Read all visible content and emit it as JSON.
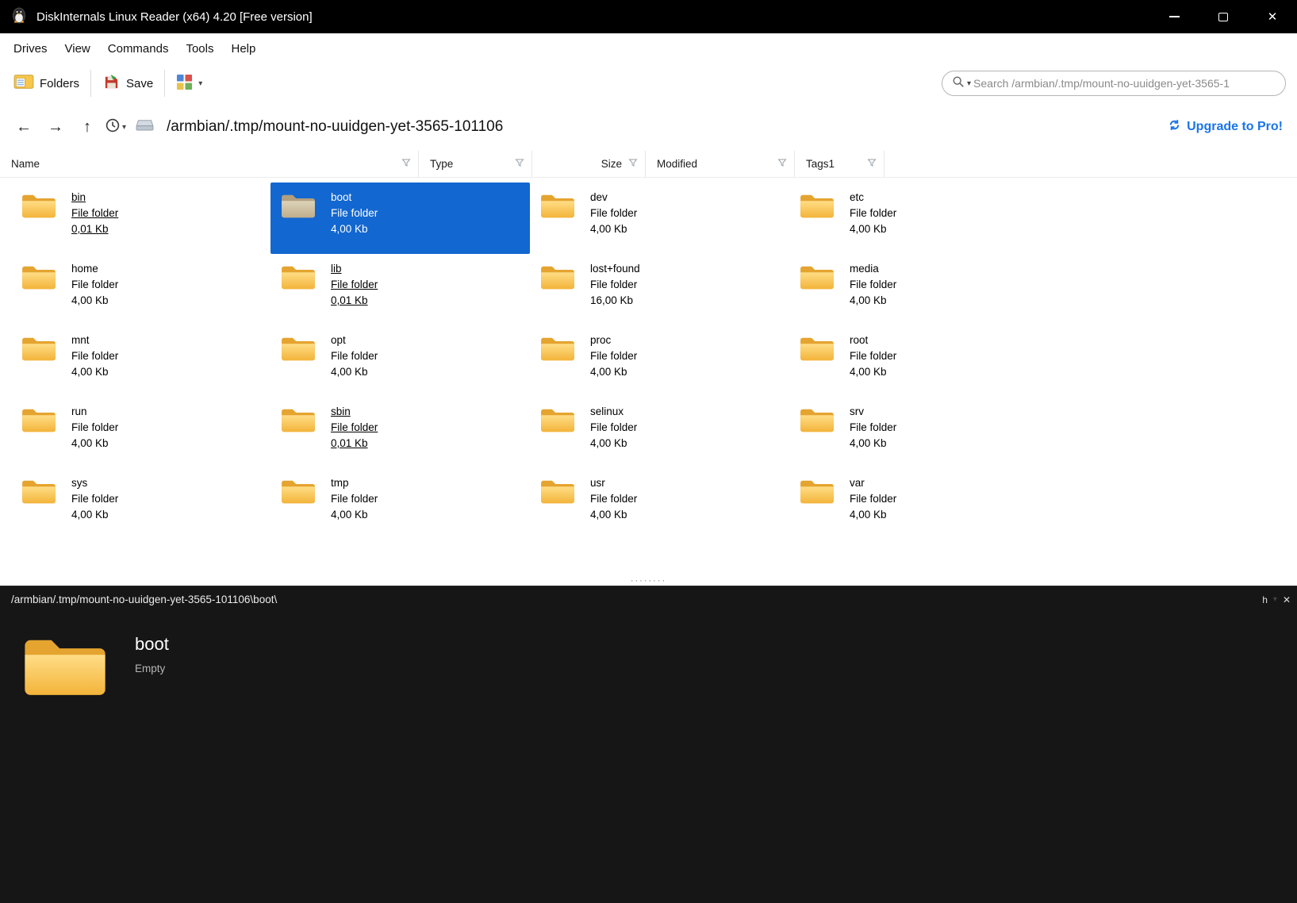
{
  "window": {
    "title": "DiskInternals Linux Reader (x64) 4.20 [Free version]"
  },
  "menu": {
    "items": [
      "Drives",
      "View",
      "Commands",
      "Tools",
      "Help"
    ]
  },
  "toolbar": {
    "folders_label": "Folders",
    "save_label": "Save",
    "search_placeholder": "Search /armbian/.tmp/mount-no-uuidgen-yet-3565-1"
  },
  "navbar": {
    "path": "/armbian/.tmp/mount-no-uuidgen-yet-3565-101106",
    "upgrade_label": "Upgrade to Pro!"
  },
  "columns": [
    {
      "label": "Name"
    },
    {
      "label": "Type"
    },
    {
      "label": "Size",
      "align": "right"
    },
    {
      "label": "Modified"
    },
    {
      "label": "Tags1"
    }
  ],
  "files": [
    {
      "name": "bin",
      "type": "File folder",
      "size": "0,01 Kb",
      "link": true,
      "selected": false
    },
    {
      "name": "boot",
      "type": "File folder",
      "size": "4,00 Kb",
      "link": false,
      "selected": true
    },
    {
      "name": "dev",
      "type": "File folder",
      "size": "4,00 Kb",
      "link": false,
      "selected": false
    },
    {
      "name": "etc",
      "type": "File folder",
      "size": "4,00 Kb",
      "link": false,
      "selected": false
    },
    {
      "name": "home",
      "type": "File folder",
      "size": "4,00 Kb",
      "link": false,
      "selected": false
    },
    {
      "name": "lib",
      "type": "File folder",
      "size": "0,01 Kb",
      "link": true,
      "selected": false
    },
    {
      "name": "lost+found",
      "type": "File folder",
      "size": "16,00 Kb",
      "link": false,
      "selected": false
    },
    {
      "name": "media",
      "type": "File folder",
      "size": "4,00 Kb",
      "link": false,
      "selected": false
    },
    {
      "name": "mnt",
      "type": "File folder",
      "size": "4,00 Kb",
      "link": false,
      "selected": false
    },
    {
      "name": "opt",
      "type": "File folder",
      "size": "4,00 Kb",
      "link": false,
      "selected": false
    },
    {
      "name": "proc",
      "type": "File folder",
      "size": "4,00 Kb",
      "link": false,
      "selected": false
    },
    {
      "name": "root",
      "type": "File folder",
      "size": "4,00 Kb",
      "link": false,
      "selected": false
    },
    {
      "name": "run",
      "type": "File folder",
      "size": "4,00 Kb",
      "link": false,
      "selected": false
    },
    {
      "name": "sbin",
      "type": "File folder",
      "size": "0,01 Kb",
      "link": true,
      "selected": false
    },
    {
      "name": "selinux",
      "type": "File folder",
      "size": "4,00 Kb",
      "link": false,
      "selected": false
    },
    {
      "name": "srv",
      "type": "File folder",
      "size": "4,00 Kb",
      "link": false,
      "selected": false
    },
    {
      "name": "sys",
      "type": "File folder",
      "size": "4,00 Kb",
      "link": false,
      "selected": false
    },
    {
      "name": "tmp",
      "type": "File folder",
      "size": "4,00 Kb",
      "link": false,
      "selected": false
    },
    {
      "name": "usr",
      "type": "File folder",
      "size": "4,00 Kb",
      "link": false,
      "selected": false
    },
    {
      "name": "var",
      "type": "File folder",
      "size": "4,00 Kb",
      "link": false,
      "selected": false
    }
  ],
  "preview": {
    "path": "/armbian/.tmp/mount-no-uuidgen-yet-3565-101106\\boot\\",
    "corner_label": "h",
    "name": "boot",
    "status": "Empty"
  },
  "icons": {
    "close": "✕",
    "caret": "▾",
    "grip": "········",
    "back": "←",
    "forward": "→",
    "up": "↑"
  },
  "colors": {
    "selection": "#1267d1",
    "accent_blue": "#1a75e8",
    "titlebar": "#000000",
    "preview_bg": "#161616",
    "folder_front": "#f5b73e",
    "folder_back": "#e5a42f"
  }
}
